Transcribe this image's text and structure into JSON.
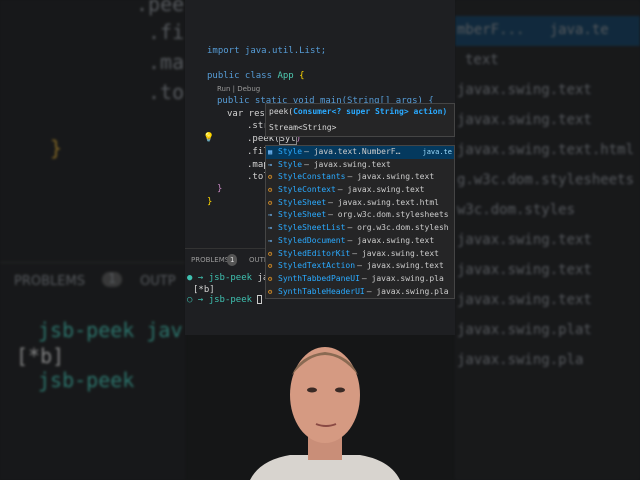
{
  "background_left": {
    "lines": [
      ".pee",
      ".fi",
      ".ma",
      ".to",
      "}"
    ],
    "panel_tab": "PROBLEMS",
    "panel_badge": "1",
    "panel_tab2": "OUTP",
    "term": [
      "jsb-peek jav",
      "[*b]",
      "jsb-peek"
    ]
  },
  "background_right": {
    "lines": [
      "mberF...   java.te",
      "text",
      "javax.swing.text",
      "javax.swing.text",
      "javax.swing.text.html",
      "g.w3c.dom.stylesheets",
      "w3c.dom.styles",
      "javax.swing.text",
      "javax.swing.text",
      "javax.swing.text",
      "javax.swing.plat",
      "javax.swing.pla"
    ]
  },
  "editor": {
    "import": "import java.util.List;",
    "class_kw": "public class",
    "class_name": "App",
    "brace": "{",
    "codelens": "Run | Debug",
    "main": "public static void main(String[] args) {",
    "var_line": "var resu",
    "chain": [
      ".str",
      ".peek(",
      ".fil",
      ".map",
      ".tol"
    ],
    "typed": "Syt",
    "close1": "}",
    "close2": "}"
  },
  "signature": {
    "method": "peek(",
    "param": "Consumer<? super String> action)",
    "returns": "Stream<String>"
  },
  "suggestions": [
    {
      "name": "Style",
      "detail": " – java.text.NumberF…",
      "right": "java.te",
      "kind": "class-c",
      "selected": true
    },
    {
      "name": "Style",
      "detail": " – javax.swing.text",
      "kind": "interface"
    },
    {
      "name": "StyleConstants",
      "detail": " – javax.swing.text",
      "kind": "class"
    },
    {
      "name": "StyleContext",
      "detail": " – javax.swing.text",
      "kind": "class"
    },
    {
      "name": "StyleSheet",
      "detail": " – javax.swing.text.html",
      "kind": "class"
    },
    {
      "name": "StyleSheet",
      "detail": " – org.w3c.dom.stylesheets",
      "kind": "interface"
    },
    {
      "name": "StyleSheetList",
      "detail": " – org.w3c.dom.stylesh",
      "kind": "interface"
    },
    {
      "name": "StyledDocument",
      "detail": " – javax.swing.text",
      "kind": "interface"
    },
    {
      "name": "StyledEditorKit",
      "detail": " – javax.swing.text",
      "kind": "class"
    },
    {
      "name": "StyledTextAction",
      "detail": " – javax.swing.text",
      "kind": "class"
    },
    {
      "name": "SynthTabbedPaneUI",
      "detail": " – javax.swing.pla",
      "kind": "class"
    },
    {
      "name": "SynthTableHeaderUI",
      "detail": " – javax.swing.pla",
      "kind": "class"
    }
  ],
  "panel": {
    "problems": "PROBLEMS",
    "badge": "1",
    "output": "OUTP"
  },
  "terminal": {
    "prompt1": "jsb-peek",
    "cmd1": "jav",
    "out": "[*b]",
    "prompt2": "jsb-peek"
  }
}
